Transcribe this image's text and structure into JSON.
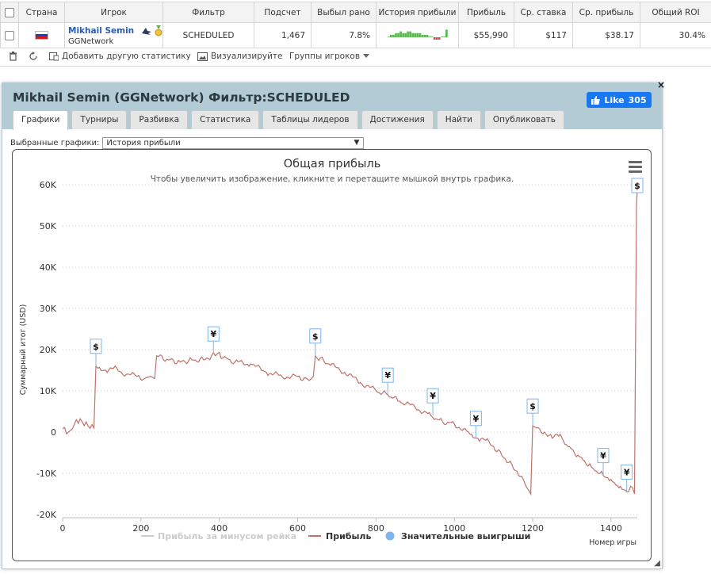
{
  "table": {
    "headers": [
      "",
      "Страна",
      "Игрок",
      "Фильтр",
      "Подсчет",
      "Выбыл рано",
      "История прибыли",
      "Прибыль",
      "Ср. ставка",
      "Ср. прибыль",
      "Общий ROI"
    ],
    "row": {
      "player_name": "Mikhail Semin",
      "network": "GGNetwork",
      "filter": "SCHEDULED",
      "count": "1,467",
      "early": "7.8%",
      "profit": "$55,990",
      "avg_stake": "$117",
      "avg_profit": "$38.17",
      "roi": "30.4%"
    }
  },
  "toolbar": {
    "add_stats": "Добавить другую статистику",
    "visualize": "Визуализируйте",
    "groups": "Группы игроков"
  },
  "panel": {
    "title": "Mikhail Semin (GGNetwork) Фильтр:SCHEDULED",
    "like_label": "Like",
    "like_count": "305",
    "close": "×",
    "tabs": [
      "Графики",
      "Турниры",
      "Разбивка",
      "Статистика",
      "Таблицы лидеров",
      "Достижения",
      "Найти",
      "Опубликовать"
    ],
    "select_label": "Выбранные графики:",
    "select_value": "История прибыли"
  },
  "chart_data": {
    "type": "line",
    "title": "Общая прибыль",
    "subtitle": "Чтобы увеличить изображение, кликните и перетащите мышкой внутрь графика.",
    "ylabel": "Суммарный итог (USD)",
    "xlabel": "Номер игры",
    "xlim": [
      0,
      1467
    ],
    "ylim": [
      -20000,
      60000
    ],
    "x_ticks": [
      0,
      200,
      400,
      600,
      800,
      1000,
      1200,
      1400
    ],
    "y_ticks": [
      -20000,
      -10000,
      0,
      10000,
      20000,
      30000,
      40000,
      50000,
      60000
    ],
    "y_tick_labels": [
      "-20K",
      "-10K",
      "0",
      "10K",
      "20K",
      "30K",
      "40K",
      "50K",
      "60K"
    ],
    "grid": true,
    "legend": [
      "Прибыль за минусом рейка",
      "Прибыль",
      "Значительные выигрыши"
    ],
    "colors": {
      "profit": "#c0716a",
      "rake": "#cccccc",
      "wins": "#7cb5ec"
    },
    "series": [
      {
        "name": "Прибыль",
        "x": [
          0,
          15,
          25,
          35,
          50,
          65,
          80,
          85,
          90,
          110,
          130,
          150,
          170,
          190,
          210,
          225,
          235,
          240,
          270,
          300,
          330,
          360,
          380,
          395,
          410,
          440,
          480,
          520,
          560,
          600,
          630,
          640,
          645,
          680,
          720,
          760,
          800,
          830,
          860,
          900,
          940,
          970,
          1000,
          1040,
          1060,
          1080,
          1100,
          1130,
          1160,
          1180,
          1195,
          1200,
          1210,
          1230,
          1250,
          1270,
          1290,
          1320,
          1350,
          1380,
          1400,
          1420,
          1440,
          1455,
          1460,
          1465,
          1467
        ],
        "y": [
          800,
          0,
          800,
          3000,
          2500,
          1500,
          1000,
          16000,
          15500,
          15000,
          15500,
          14500,
          14000,
          13500,
          13000,
          13500,
          13000,
          18500,
          17500,
          17000,
          17500,
          17500,
          18500,
          19000,
          18000,
          17000,
          16500,
          14500,
          13500,
          13500,
          12500,
          13500,
          18500,
          16500,
          14500,
          12000,
          10000,
          9000,
          7500,
          6000,
          4000,
          2500,
          2000,
          -500,
          -1500,
          -2000,
          -3500,
          -6500,
          -9500,
          -12500,
          -15000,
          1500,
          1000,
          0,
          -1500,
          -500,
          -3500,
          -6000,
          -8500,
          -10500,
          -11500,
          -13500,
          -14500,
          -13500,
          -15000,
          55000,
          59000
        ]
      }
    ],
    "markers": [
      {
        "x": 85,
        "y": 16000,
        "symbol": "$"
      },
      {
        "x": 385,
        "y": 19000,
        "symbol": "¥"
      },
      {
        "x": 645,
        "y": 18500,
        "symbol": "$"
      },
      {
        "x": 830,
        "y": 9000,
        "symbol": "¥"
      },
      {
        "x": 945,
        "y": 4000,
        "symbol": "¥"
      },
      {
        "x": 1055,
        "y": -1500,
        "symbol": "¥"
      },
      {
        "x": 1200,
        "y": 1500,
        "symbol": "$"
      },
      {
        "x": 1380,
        "y": -10500,
        "symbol": "¥"
      },
      {
        "x": 1440,
        "y": -14500,
        "symbol": "¥"
      },
      {
        "x": 1467,
        "y": 59000,
        "symbol": "$"
      }
    ],
    "sparkline_values": [
      0,
      1,
      1,
      2,
      2,
      3,
      2,
      2,
      3,
      3,
      2,
      2,
      2,
      2,
      1,
      1,
      1,
      0,
      0,
      -1,
      -1,
      -1,
      0,
      0,
      4
    ]
  }
}
